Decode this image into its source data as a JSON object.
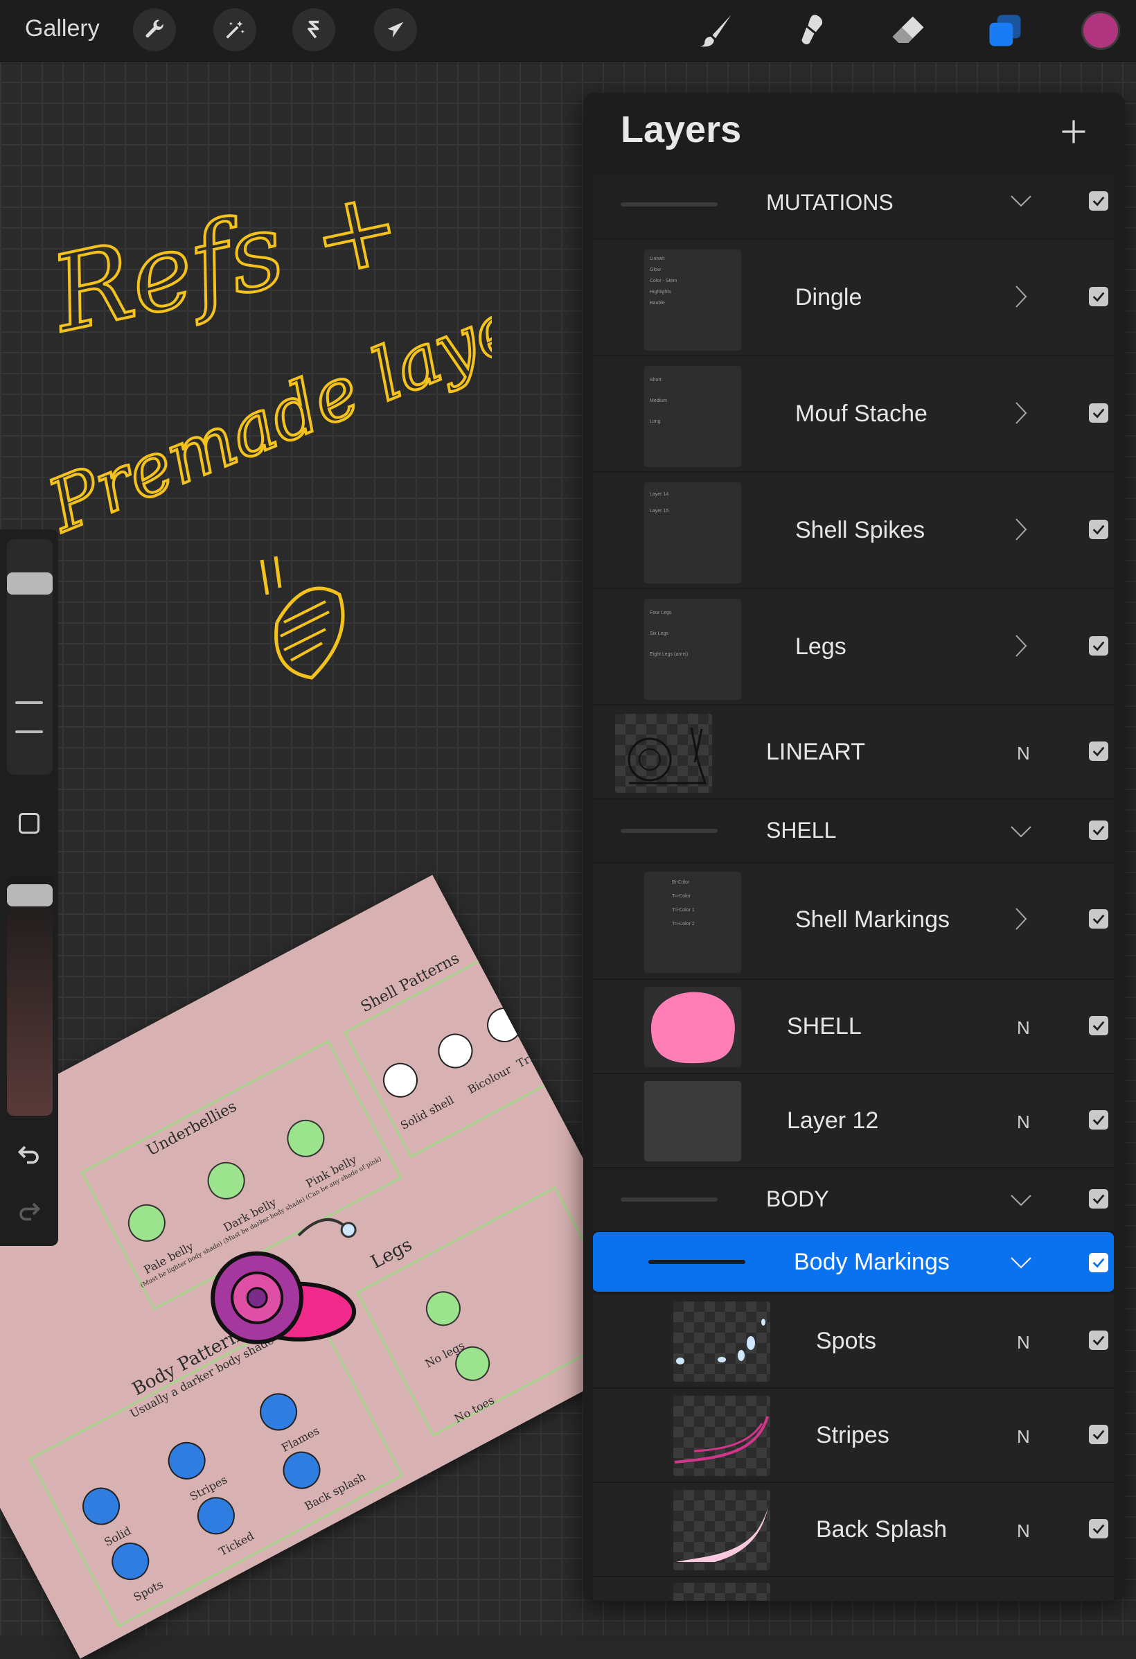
{
  "toolbar": {
    "gallery_label": "Gallery",
    "left_tools": [
      "wrench-icon",
      "magic-wand-icon",
      "selection-icon",
      "transform-icon"
    ],
    "right_tools": [
      "brush-icon",
      "smudge-icon",
      "eraser-icon",
      "layers-icon"
    ],
    "accent_color": "#1a7cf4",
    "current_color": "#b0357e"
  },
  "canvas_note": {
    "line1": "Refs +",
    "line2": "Premade layers"
  },
  "artwork": {
    "sections": [
      {
        "title": "Underbellies",
        "items": [
          "Pale belly",
          "Dark belly",
          "Pink belly"
        ],
        "notes": [
          "(Must be lighter body shade)",
          "(Must be darker body shade)",
          "(Can be any shade of pink)"
        ]
      },
      {
        "title": "Shell Patterns",
        "items": [
          "Solid shell",
          "Bicolour",
          "Tricolour"
        ]
      },
      {
        "title": "Body Patterns",
        "subtitle": "Usually a darker body shade",
        "items": [
          "Solid",
          "Stripes",
          "Flames",
          "Spots",
          "Ticked",
          "Back splash"
        ]
      },
      {
        "title": "Legs",
        "items": [
          "No legs",
          "No toes"
        ]
      }
    ]
  },
  "layers": {
    "title": "Layers",
    "add_icon": "plus-icon",
    "rows": [
      {
        "name": "MUTATIONS",
        "kind": "group-header",
        "control": "chevron-down",
        "visible": true
      },
      {
        "name": "Dingle",
        "kind": "group",
        "control": "chevron-right",
        "visible": true
      },
      {
        "name": "Mouf Stache",
        "kind": "group",
        "control": "chevron-right",
        "visible": true
      },
      {
        "name": "Shell Spikes",
        "kind": "group",
        "control": "chevron-right",
        "visible": true
      },
      {
        "name": "Legs",
        "kind": "group",
        "control": "chevron-right",
        "visible": true
      },
      {
        "name": "LINEART",
        "kind": "layer",
        "blend": "N",
        "visible": true
      },
      {
        "name": "SHELL",
        "kind": "group-header",
        "control": "chevron-down",
        "visible": true
      },
      {
        "name": "Shell Markings",
        "kind": "group",
        "control": "chevron-right",
        "visible": true
      },
      {
        "name": "SHELL",
        "kind": "layer",
        "blend": "N",
        "visible": true
      },
      {
        "name": "Layer 12",
        "kind": "layer",
        "blend": "N",
        "visible": true
      },
      {
        "name": "BODY",
        "kind": "group-header",
        "control": "chevron-down",
        "visible": true
      },
      {
        "name": "Body Markings",
        "kind": "group-header",
        "control": "chevron-down",
        "visible": true,
        "selected": true
      },
      {
        "name": "Spots",
        "kind": "layer",
        "blend": "N",
        "visible": true
      },
      {
        "name": "Stripes",
        "kind": "layer",
        "blend": "N",
        "visible": true
      },
      {
        "name": "Back Splash",
        "kind": "layer",
        "blend": "N",
        "visible": true
      }
    ],
    "group_thumbnails": {
      "dingle": [
        "Lineart",
        "Glow",
        "Color - Stem",
        "Highlights",
        "Bauble"
      ],
      "mouf_stache": [
        "Short",
        "Medium",
        "Long"
      ],
      "shell_spikes": [
        "Layer 14",
        "Layer 15"
      ],
      "legs": [
        "Four Legs",
        "Six Legs",
        "Eight Legs (arms)"
      ],
      "shell_markings": [
        "Bi-Color",
        "Tri-Color",
        "Tri-Color 1",
        "Tri-Color 2"
      ]
    }
  }
}
